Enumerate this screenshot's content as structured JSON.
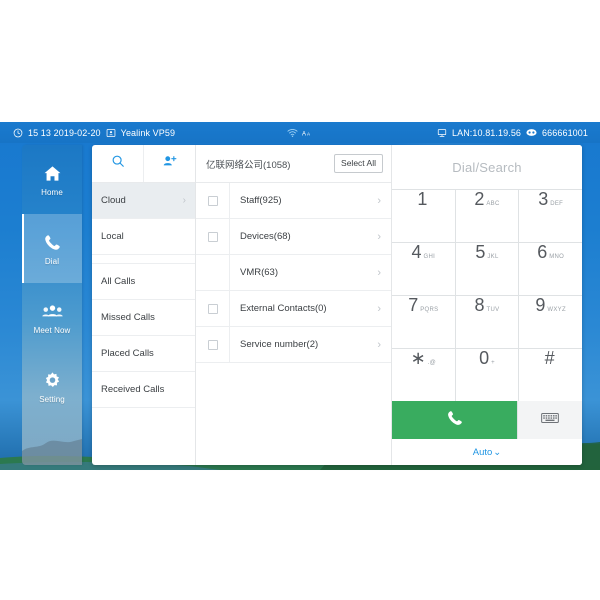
{
  "statusbar": {
    "clock_icon": "clock-icon",
    "time_date": "15 13 2019-02-20",
    "account_icon": "contact-card-icon",
    "device_model": "Yealink VP59",
    "wifi_icon": "wifi-icon",
    "font_icon": "font-size-icon",
    "network_icon": "lan-icon",
    "lan_text": "LAN:10.81.19.56",
    "line_icon": "sip-account-icon",
    "line_number": "666661001"
  },
  "navrail": {
    "items": [
      {
        "label": "Home",
        "icon": "home-icon",
        "selected": false
      },
      {
        "label": "Dial",
        "icon": "phone-icon",
        "selected": true
      },
      {
        "label": "Meet Now",
        "icon": "group-icon",
        "selected": false
      },
      {
        "label": "Setting",
        "icon": "gear-icon",
        "selected": false
      }
    ]
  },
  "directory": {
    "toolbar": [
      {
        "icon": "search-icon",
        "name": "search-button"
      },
      {
        "icon": "add-contact-icon",
        "name": "add-contact-button"
      }
    ],
    "categories": [
      {
        "label": "Cloud",
        "selected": true,
        "chevron": "›"
      },
      {
        "label": "Local",
        "selected": false,
        "chevron": ""
      },
      {
        "label": "All Calls",
        "selected": false,
        "chevron": ""
      },
      {
        "label": "Missed Calls",
        "selected": false,
        "chevron": ""
      },
      {
        "label": "Placed Calls",
        "selected": false,
        "chevron": ""
      },
      {
        "label": "Received Calls",
        "selected": false,
        "chevron": ""
      }
    ]
  },
  "groups": {
    "company": "亿联网络公司(1058)",
    "select_all_label": "Select All",
    "rows": [
      {
        "label": "Staff(925)",
        "has_checkbox": true,
        "checked": false,
        "chevron": "›"
      },
      {
        "label": "Devices(68)",
        "has_checkbox": true,
        "checked": false,
        "chevron": "›"
      },
      {
        "label": "VMR(63)",
        "has_checkbox": false,
        "checked": false,
        "chevron": "›"
      },
      {
        "label": "External Contacts(0)",
        "has_checkbox": true,
        "checked": false,
        "chevron": "›"
      },
      {
        "label": "Service number(2)",
        "has_checkbox": true,
        "checked": false,
        "chevron": "›"
      }
    ]
  },
  "dialpad": {
    "input_value": "",
    "input_placeholder": "Dial/Search",
    "keys": [
      {
        "digit": "1",
        "sub": ""
      },
      {
        "digit": "2",
        "sub": "ABC"
      },
      {
        "digit": "3",
        "sub": "DEF"
      },
      {
        "digit": "4",
        "sub": "GHI"
      },
      {
        "digit": "5",
        "sub": "JKL"
      },
      {
        "digit": "6",
        "sub": "MNO"
      },
      {
        "digit": "7",
        "sub": "PQRS"
      },
      {
        "digit": "8",
        "sub": "TUV"
      },
      {
        "digit": "9",
        "sub": "WXYZ"
      },
      {
        "digit": "∗",
        "sub": ".@"
      },
      {
        "digit": "0",
        "sub": "+"
      },
      {
        "digit": "#",
        "sub": ""
      }
    ],
    "call_icon": "phone-icon",
    "keyboard_icon": "keyboard-icon",
    "mode_label": "Auto",
    "mode_chevron": "⌄"
  },
  "colors": {
    "status_bar": "#1a7ace",
    "accent_blue": "#2196e3",
    "call_green": "#39ac5f",
    "selected_row": "#e9edf0"
  }
}
